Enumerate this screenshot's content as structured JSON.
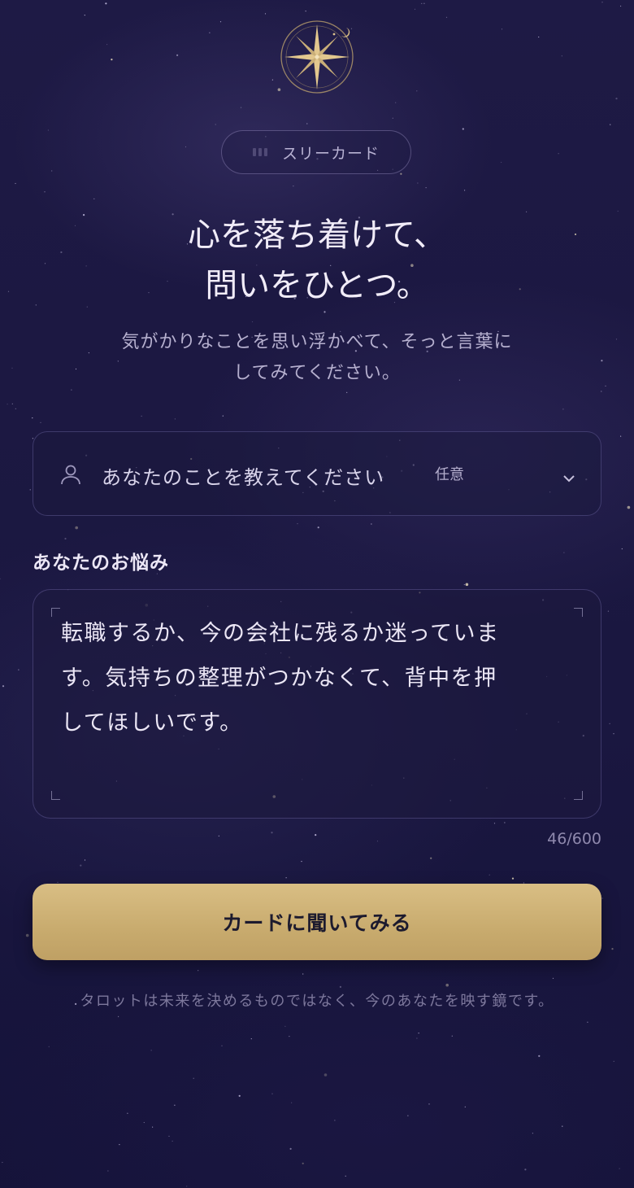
{
  "header": {
    "emblem_icon": "compass-star-moon-icon",
    "mode_label": "スリーカード"
  },
  "intro": {
    "headline_line1": "心を落ち着けて、",
    "headline_line2": "問いをひとつ。",
    "subtext_line1": "気がかりなことを思い浮かべて、そっと言葉に",
    "subtext_line2": "してみてください。"
  },
  "profile": {
    "icon": "person-icon",
    "label": "あなたのことを教えてください",
    "optional_badge": "任意",
    "expand_icon": "chevron-down-icon"
  },
  "concern": {
    "label": "あなたのお悩み",
    "value_line1": "転職するか、今の会社に残るか迷っていま",
    "value_line2": "す。気持ちの整理がつかなくて、背中を押",
    "value_line3": "してほしいです。",
    "counter": "46/600"
  },
  "actions": {
    "submit_label": "カードに聞いてみる"
  },
  "footer": {
    "note": "タロットは未来を決めるものではなく、今のあなたを映す鏡です。"
  },
  "colors": {
    "background": "#1c1842",
    "accent_gold": "#cdb175",
    "text_primary": "#ece7f6",
    "text_muted": "#b6b0cf"
  }
}
